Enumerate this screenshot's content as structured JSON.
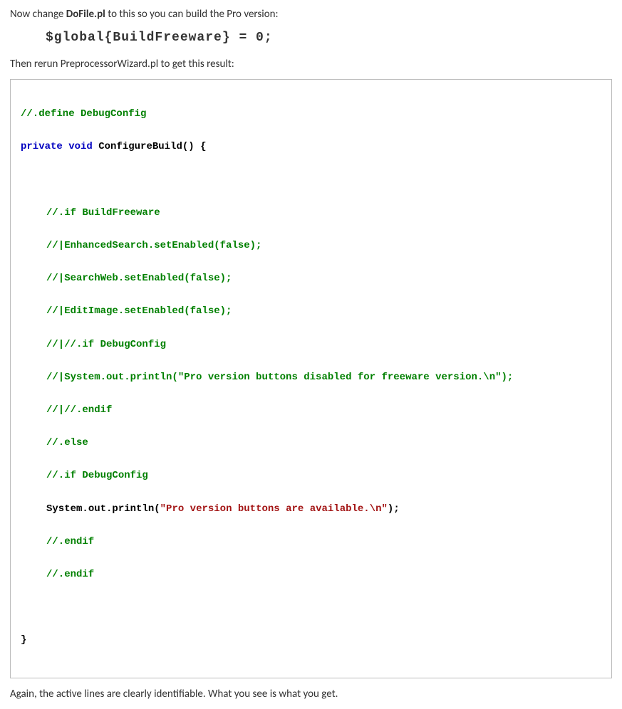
{
  "intro1_pre": "Now change ",
  "intro1_file": "DoFile.pl",
  "intro1_post": " to this so you can build the Pro version:",
  "inline_code": "$global{BuildFreeware} = 0;",
  "intro2": "Then rerun PreprocessorWizard.pl to get this result:",
  "code": {
    "l1_cmt": "//.define DebugConfig",
    "l2_kw1": "private",
    "l2_kw2": "void",
    "l2_name": "ConfigureBuild",
    "l2_rest": "() {",
    "l3": "//.if BuildFreeware",
    "l4": "//|EnhancedSearch.setEnabled(false);",
    "l5": "//|SearchWeb.setEnabled(false);",
    "l6": "//|EditImage.setEnabled(false);",
    "l7": "//|//.if DebugConfig",
    "l8": "//|System.out.println(\"Pro version buttons disabled for freeware version.\\n\");",
    "l9": "//|//.endif",
    "l10": "//.else",
    "l11": "//.if DebugConfig",
    "l12_a": "System.",
    "l12_b": "out",
    "l12_c": ".println(",
    "l12_str": "\"Pro version buttons are available.\\n\"",
    "l12_d": ");",
    "l13": "//.endif",
    "l14": "//.endif",
    "l15": "}"
  },
  "outro": "Again, the active lines are clearly identifiable.  What you see is what you get."
}
